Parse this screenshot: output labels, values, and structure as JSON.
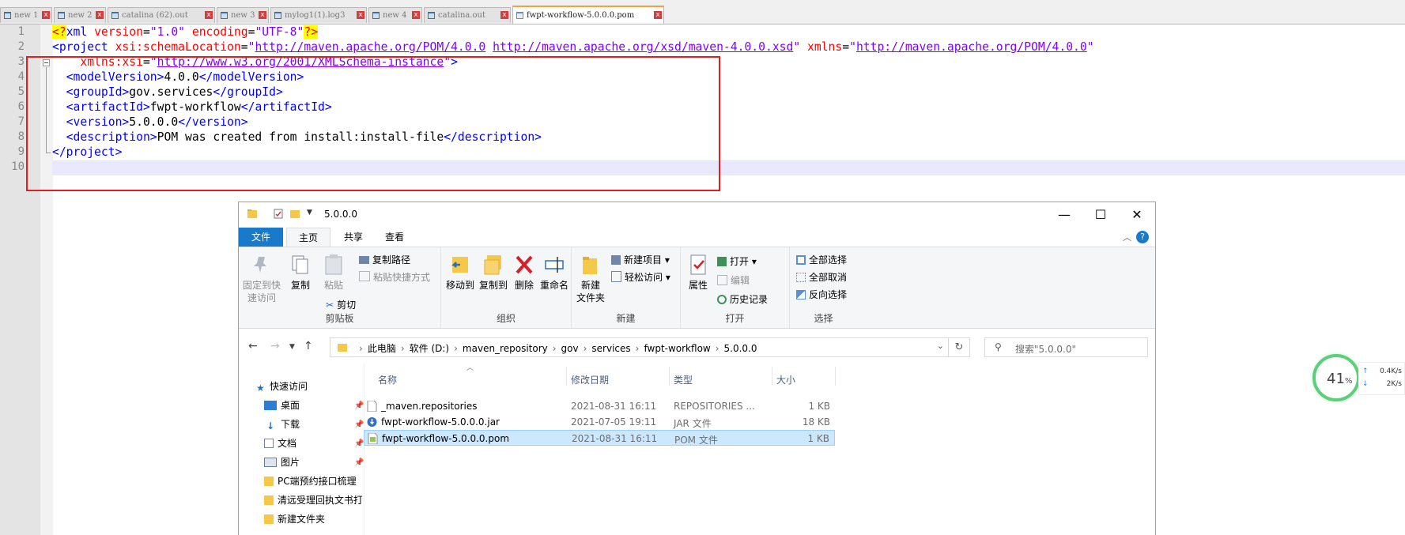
{
  "notepad": {
    "tabs": [
      {
        "label": "new 1",
        "close": "x"
      },
      {
        "label": "new 2",
        "close": "x"
      },
      {
        "label": "catalina (62).out",
        "close": "x"
      },
      {
        "label": "new 3",
        "close": "x"
      },
      {
        "label": "mylog1(1).log3",
        "close": "x"
      },
      {
        "label": "new 4",
        "close": "x"
      },
      {
        "label": "catalina.out",
        "close": "x"
      },
      {
        "label": "fwpt-workflow-5.0.0.0.pom",
        "close": "x",
        "active": true
      }
    ],
    "line_numbers": [
      "1",
      "2",
      "3",
      "4",
      "5",
      "6",
      "7",
      "8",
      "9",
      "10"
    ],
    "xml": {
      "l1_pi_open": "<?",
      "l1_xml": "xml ",
      "l1_attr1": "version",
      "l1_eq": "=",
      "l1_val1": "\"1.0\"",
      "l1_attr2": " encoding",
      "l1_val2": "\"UTF-8\"",
      "l1_pi_close": "?>",
      "l2_tag": "<project ",
      "l2_attr1": "xsi:schemaLocation",
      "l2_q1": "\"",
      "l2_url1": "http://maven.apache.org/POM/4.0.0",
      "l2_space": " ",
      "l2_url2": "http://maven.apache.org/xsd/maven-4.0.0.xsd",
      "l2_attr2": " xmlns",
      "l2_url3": "http://maven.apache.org/POM/4.0.0",
      "l3_attr": "    xmlns:xsi",
      "l3_url": "http://www.w3.org/2001/XMLSchema-instance",
      "l3_end": ">",
      "model_open": "  <modelVersion>",
      "model_val": "4.0.0",
      "model_close": "</modelVersion>",
      "group_open": "  <groupId>",
      "group_val": "gov.services",
      "group_close": "</groupId>",
      "art_open": "  <artifactId>",
      "art_val": "fwpt-workflow",
      "art_close": "</artifactId>",
      "ver_open": "  <version>",
      "ver_val": "5.0.0.0",
      "ver_close": "</version>",
      "desc_open": "  <description>",
      "desc_val": "POM was created from install:install-file",
      "desc_close": "</description>",
      "proj_close": "</project>"
    }
  },
  "explorer": {
    "title": "5.0.0.0",
    "window_buttons": {
      "minimize": "—",
      "maximize": "☐",
      "close": "✕"
    },
    "ribbon_tabs": [
      "文件",
      "主页",
      "共享",
      "查看"
    ],
    "ribbon": {
      "clipboard": {
        "pin": "固定到快\n速访问",
        "copy": "复制",
        "paste": "粘贴",
        "copy_path": "复制路径",
        "paste_shortcut": "粘贴快捷方式",
        "cut": "剪切",
        "label": "剪贴板"
      },
      "organize": {
        "move_to": "移动到",
        "copy_to": "复制到",
        "delete": "删除",
        "rename": "重命名",
        "label": "组织"
      },
      "new": {
        "new_folder": "新建\n文件夹",
        "new_item": "新建项目",
        "easy_access": "轻松访问",
        "label": "新建"
      },
      "open": {
        "properties": "属性",
        "open": "打开",
        "edit": "编辑",
        "history": "历史记录",
        "label": "打开"
      },
      "select": {
        "select_all": "全部选择",
        "select_none": "全部取消",
        "invert": "反向选择",
        "label": "选择"
      }
    },
    "breadcrumb": [
      "此电脑",
      "软件 (D:)",
      "maven_repository",
      "gov",
      "services",
      "fwpt-workflow",
      "5.0.0.0"
    ],
    "search_placeholder": "搜索\"5.0.0.0\"",
    "nav": [
      {
        "label": "快速访问",
        "icon": "star-icon"
      },
      {
        "label": "桌面",
        "icon": "desktop-icon",
        "pinned": true
      },
      {
        "label": "下载",
        "icon": "download-icon",
        "pinned": true
      },
      {
        "label": "文档",
        "icon": "document-icon",
        "pinned": true
      },
      {
        "label": "图片",
        "icon": "picture-icon",
        "pinned": true
      },
      {
        "label": "PC端预约接口梳理",
        "icon": "folder-icon"
      },
      {
        "label": "清远受理回执文书打",
        "icon": "folder-icon"
      },
      {
        "label": "新建文件夹",
        "icon": "folder-icon"
      }
    ],
    "columns": {
      "name": "名称",
      "modified": "修改日期",
      "type": "类型",
      "size": "大小"
    },
    "files": [
      {
        "name": "_maven.repositories",
        "modified": "2021-08-31 16:11",
        "type": "REPOSITORIES ...",
        "size": "1 KB"
      },
      {
        "name": "fwpt-workflow-5.0.0.0.jar",
        "modified": "2021-07-05 19:11",
        "type": "JAR 文件",
        "size": "18 KB"
      },
      {
        "name": "fwpt-workflow-5.0.0.0.pom",
        "modified": "2021-08-31 16:11",
        "type": "POM 文件",
        "size": "1 KB",
        "selected": true
      }
    ]
  },
  "net_widget": {
    "percent": "41",
    "percent_sign": "%",
    "up": "0.4K/s",
    "down": "2K/s"
  },
  "colors": {
    "accent_blue": "#1979ca",
    "highlight_red": "#e02020",
    "selection": "#cce8ff",
    "ring_green": "#5ccf7a"
  }
}
